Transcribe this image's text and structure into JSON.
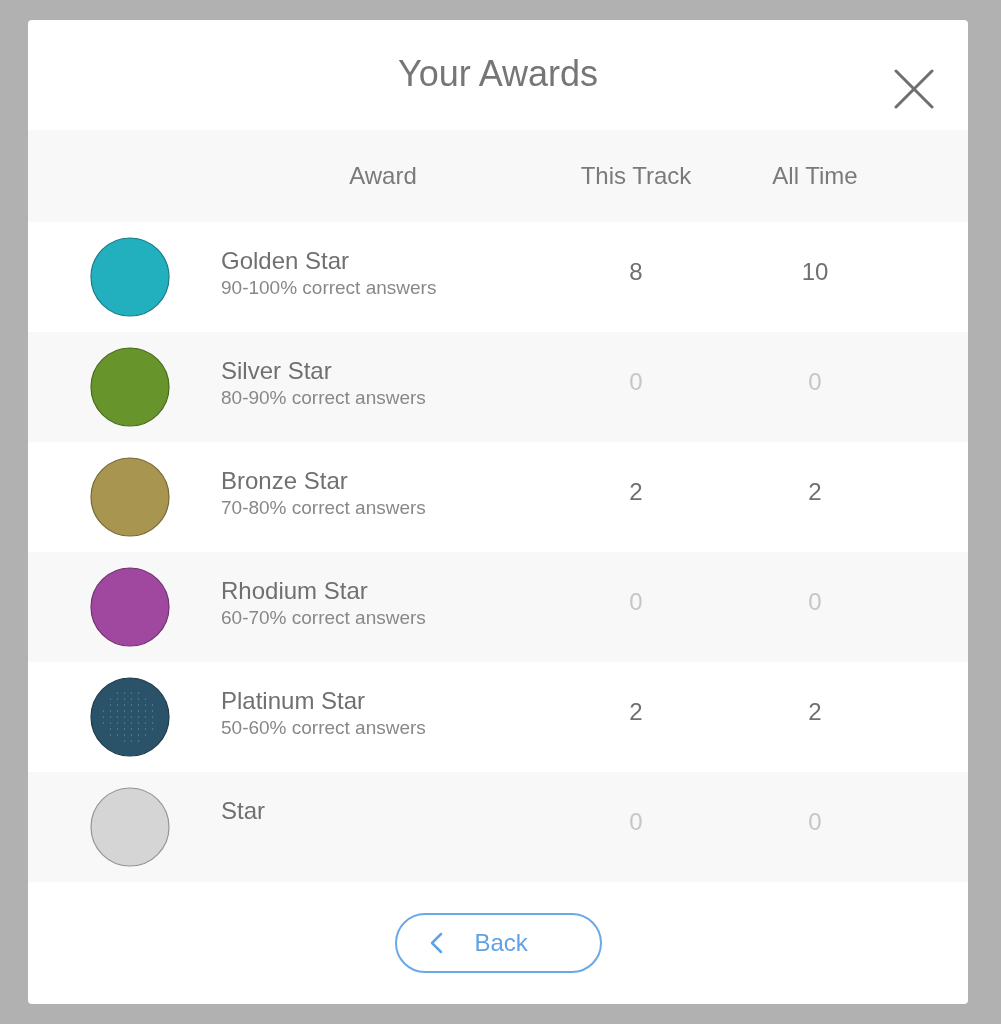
{
  "dialog": {
    "title": "Your Awards"
  },
  "table": {
    "columns": [
      "Award",
      "This Track",
      "All Time"
    ],
    "rows": [
      {
        "name": "Golden Star",
        "description": "90-100% correct answers",
        "color": "#22b0bf",
        "kind": "plain",
        "this_track": "8",
        "all_time": "10",
        "earned": true
      },
      {
        "name": "Silver Star",
        "description": "80-90% correct answers",
        "color": "#67952b",
        "kind": "plain",
        "this_track": "0",
        "all_time": "0",
        "earned": false
      },
      {
        "name": "Bronze Star",
        "description": "70-80% correct answers",
        "color": "#a8954f",
        "kind": "plain",
        "this_track": "2",
        "all_time": "2",
        "earned": true
      },
      {
        "name": "Rhodium Star",
        "description": "60-70% correct answers",
        "color": "#a0479f",
        "kind": "plain",
        "this_track": "0",
        "all_time": "0",
        "earned": false
      },
      {
        "name": "Platinum Star",
        "description": "50-60% correct answers",
        "color": "#2a5369",
        "kind": "speckled",
        "this_track": "2",
        "all_time": "2",
        "earned": true
      },
      {
        "name": "Star",
        "color": "#d5d5d5",
        "kind": "plain",
        "this_track": "0",
        "all_time": "0",
        "earned": false
      }
    ]
  },
  "footer": {
    "back_button": "Back"
  }
}
